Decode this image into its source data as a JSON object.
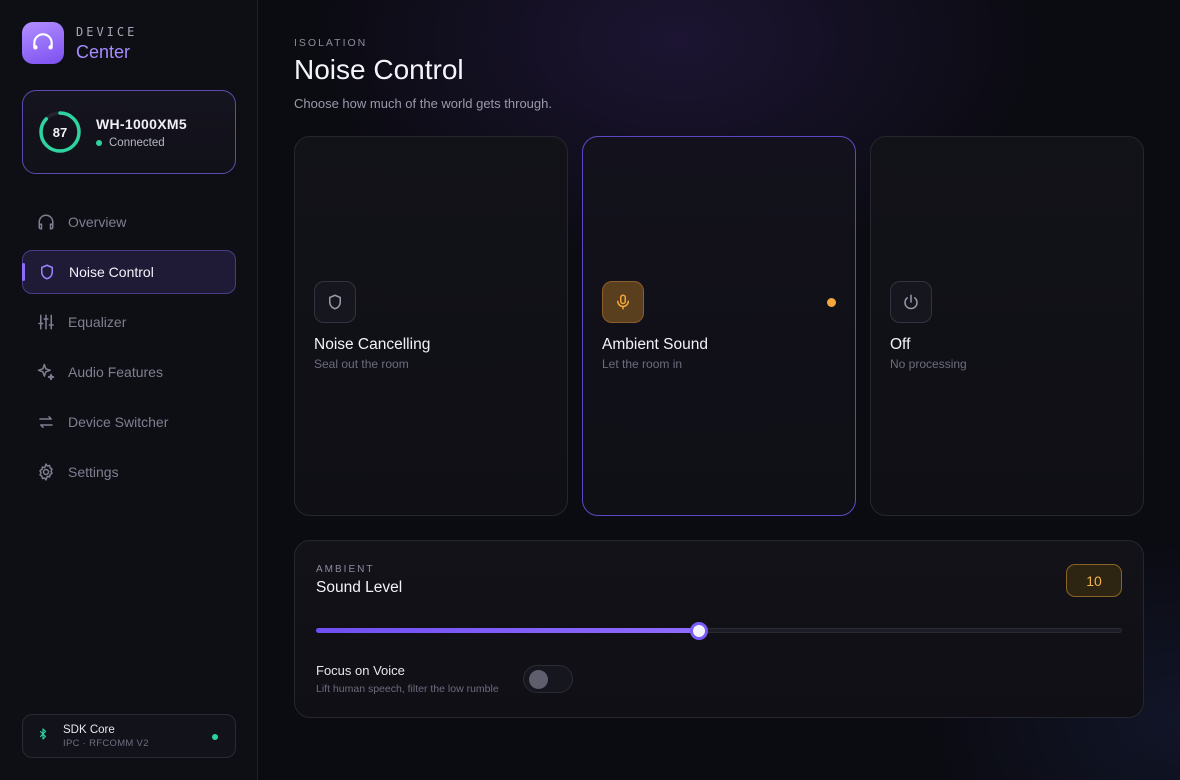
{
  "brand": {
    "line1": "DEVICE",
    "line2": "Center",
    "logo_icon": "headphones-icon"
  },
  "device": {
    "battery": 87,
    "name": "WH-1000XM5",
    "status": "Connected",
    "status_color": "#2fd3a0"
  },
  "nav": {
    "items": [
      {
        "label": "Overview",
        "icon": "headphones-icon",
        "active": false
      },
      {
        "label": "Noise Control",
        "icon": "shield-icon",
        "active": true
      },
      {
        "label": "Equalizer",
        "icon": "equalizer-icon",
        "active": false
      },
      {
        "label": "Audio Features",
        "icon": "sparkle-icon",
        "active": false
      },
      {
        "label": "Device Switcher",
        "icon": "switch-arrows-icon",
        "active": false
      },
      {
        "label": "Settings",
        "icon": "gear-icon",
        "active": false
      }
    ]
  },
  "sdk": {
    "title": "SDK Core",
    "subtitle": "IPC · RFCOMM V2",
    "icon": "bluetooth-icon"
  },
  "page": {
    "eyebrow": "ISOLATION",
    "title": "Noise Control",
    "subtitle": "Choose how much of the world gets through."
  },
  "modes": [
    {
      "title": "Noise Cancelling",
      "subtitle": "Seal out the room",
      "icon": "shield-icon",
      "selected": false
    },
    {
      "title": "Ambient Sound",
      "subtitle": "Let the room in",
      "icon": "microphone-icon",
      "selected": true
    },
    {
      "title": "Off",
      "subtitle": "No processing",
      "icon": "power-icon",
      "selected": false
    }
  ],
  "ambient": {
    "eyebrow": "AMBIENT",
    "title": "Sound Level",
    "level": "10",
    "level_fraction": 0.475,
    "focus_voice": {
      "label": "Focus on Voice",
      "description": "Lift human speech, filter the low rumble",
      "enabled": false
    }
  },
  "colors": {
    "accent": "#8c6bff",
    "amber": "#f4a63a",
    "success": "#2fd3a0"
  }
}
